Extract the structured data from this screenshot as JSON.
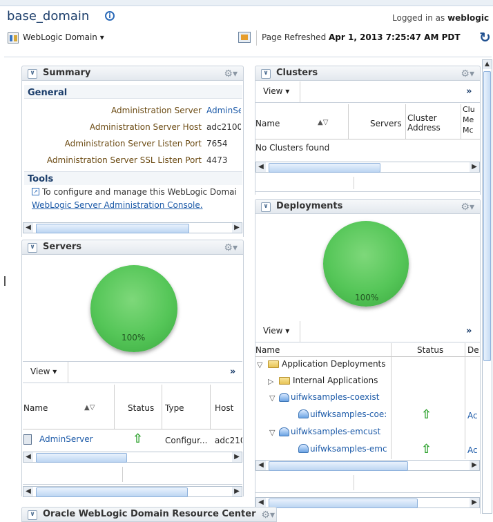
{
  "header": {
    "title": "base_domain",
    "logged_in_label": "Logged in as",
    "logged_in_user": "weblogic",
    "domain_menu": "WebLogic Domain ▾",
    "page_refreshed_label": "Page Refreshed",
    "page_refreshed_time": "Apr 1, 2013 7:25:47 AM PDT"
  },
  "summary": {
    "title": "Summary",
    "general": "General",
    "rows": [
      {
        "label": "Administration Server",
        "value": "AdminSer"
      },
      {
        "label": "Administration Server Host",
        "value": "adc2100:"
      },
      {
        "label": "Administration Server Listen Port",
        "value": "7654"
      },
      {
        "label": "Administration Server SSL Listen Port",
        "value": "4473"
      }
    ],
    "tools": "Tools",
    "tools_text": "To configure and manage this WebLogic Domai",
    "tools_link": "WebLogic Server Administration Console."
  },
  "servers": {
    "title": "Servers",
    "pie_label": "100%",
    "view": "View ▾",
    "more": "»",
    "columns": [
      "Name",
      "Status",
      "Type",
      "Host"
    ],
    "rows": [
      {
        "name": "AdminServer",
        "type": "Configur...",
        "host": "adc210"
      }
    ]
  },
  "clusters": {
    "title": "Clusters",
    "view": "View ▾",
    "more": "»",
    "columns": [
      "Name",
      "Servers",
      "Cluster Address",
      "Clu Me Mc"
    ],
    "empty": "No Clusters found"
  },
  "deployments": {
    "title": "Deployments",
    "pie_label": "100%",
    "view": "View ▾",
    "more": "»",
    "columns": [
      "Name",
      "Status",
      "De"
    ],
    "rows": [
      {
        "indent": 0,
        "toggle": "▽",
        "icon": "folder",
        "name": "Application Deployments",
        "status": false,
        "extra": ""
      },
      {
        "indent": 1,
        "toggle": "▷",
        "icon": "folder",
        "name": "Internal Applications",
        "status": false,
        "extra": ""
      },
      {
        "indent": 1,
        "toggle": "▽",
        "icon": "app",
        "name": "uifwksamples-coexist",
        "status": false,
        "extra": ""
      },
      {
        "indent": 2,
        "toggle": "",
        "icon": "app",
        "name": "uifwksamples-coe:",
        "status": true,
        "extra": "Ac"
      },
      {
        "indent": 1,
        "toggle": "▽",
        "icon": "app",
        "name": "uifwksamples-emcust",
        "status": false,
        "extra": ""
      },
      {
        "indent": 2,
        "toggle": "",
        "icon": "app",
        "name": "uifwksamples-emc",
        "status": true,
        "extra": "Ac"
      }
    ]
  },
  "resource_center": {
    "title": "Oracle WebLogic Domain Resource Center"
  },
  "colors": {
    "title": "#1c3e6b",
    "link": "#1c5aa8",
    "label": "#6b4a12",
    "pie": "#55c658",
    "status_up": "#2aa02a"
  },
  "icons": [
    "info-icon",
    "domain-menu-icon",
    "refresh-icon",
    "gear-icon",
    "chevron-icon",
    "arrow-up-icon",
    "folder-icon",
    "app-icon",
    "external-link-icon"
  ]
}
